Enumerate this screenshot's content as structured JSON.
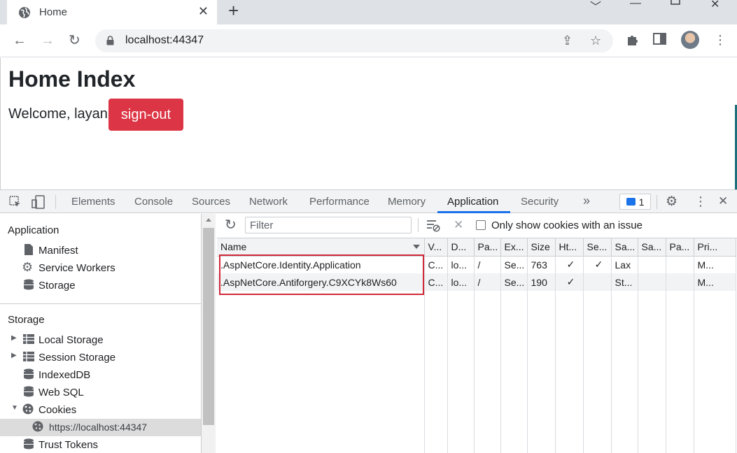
{
  "browser": {
    "tab_title": "Home",
    "url": "localhost:44347"
  },
  "page": {
    "heading": "Home Index",
    "welcome_text": "Welcome, layan",
    "signout_label": "sign-out"
  },
  "devtools": {
    "tabs": [
      "Elements",
      "Console",
      "Sources",
      "Network",
      "Performance",
      "Memory",
      "Application",
      "Security"
    ],
    "active_tab": "Application",
    "more_tabs": "»",
    "issues_count": "1",
    "sidebar": {
      "application_header": "Application",
      "application_items": [
        "Manifest",
        "Service Workers",
        "Storage"
      ],
      "storage_header": "Storage",
      "storage_items": [
        "Local Storage",
        "Session Storage",
        "IndexedDB",
        "Web SQL",
        "Cookies"
      ],
      "cookie_origin": "https://localhost:44347",
      "trust_tokens": "Trust Tokens"
    },
    "cookies": {
      "filter_placeholder": "Filter",
      "only_issues_label": "Only show cookies with an issue",
      "columns": [
        "Name",
        "V...",
        "D...",
        "Pa...",
        "Ex...",
        "Size",
        "Ht...",
        "Se...",
        "Sa...",
        "Sa...",
        "Pa...",
        "Pri..."
      ],
      "rows": [
        [
          ".AspNetCore.Identity.Application",
          "C...",
          "lo...",
          "/",
          "Se...",
          "763",
          "✓",
          "✓",
          "Lax",
          "",
          "",
          "M..."
        ],
        [
          ".AspNetCore.Antiforgery.C9XCYk8Ws60",
          "C...",
          "lo...",
          "/",
          "Se...",
          "190",
          "✓",
          "",
          "St...",
          "",
          "",
          "M..."
        ]
      ]
    }
  },
  "colors": {
    "signout_bg": "#dc3545",
    "active_tab_underline": "#1a73e8",
    "highlight_box": "#d0293a"
  }
}
